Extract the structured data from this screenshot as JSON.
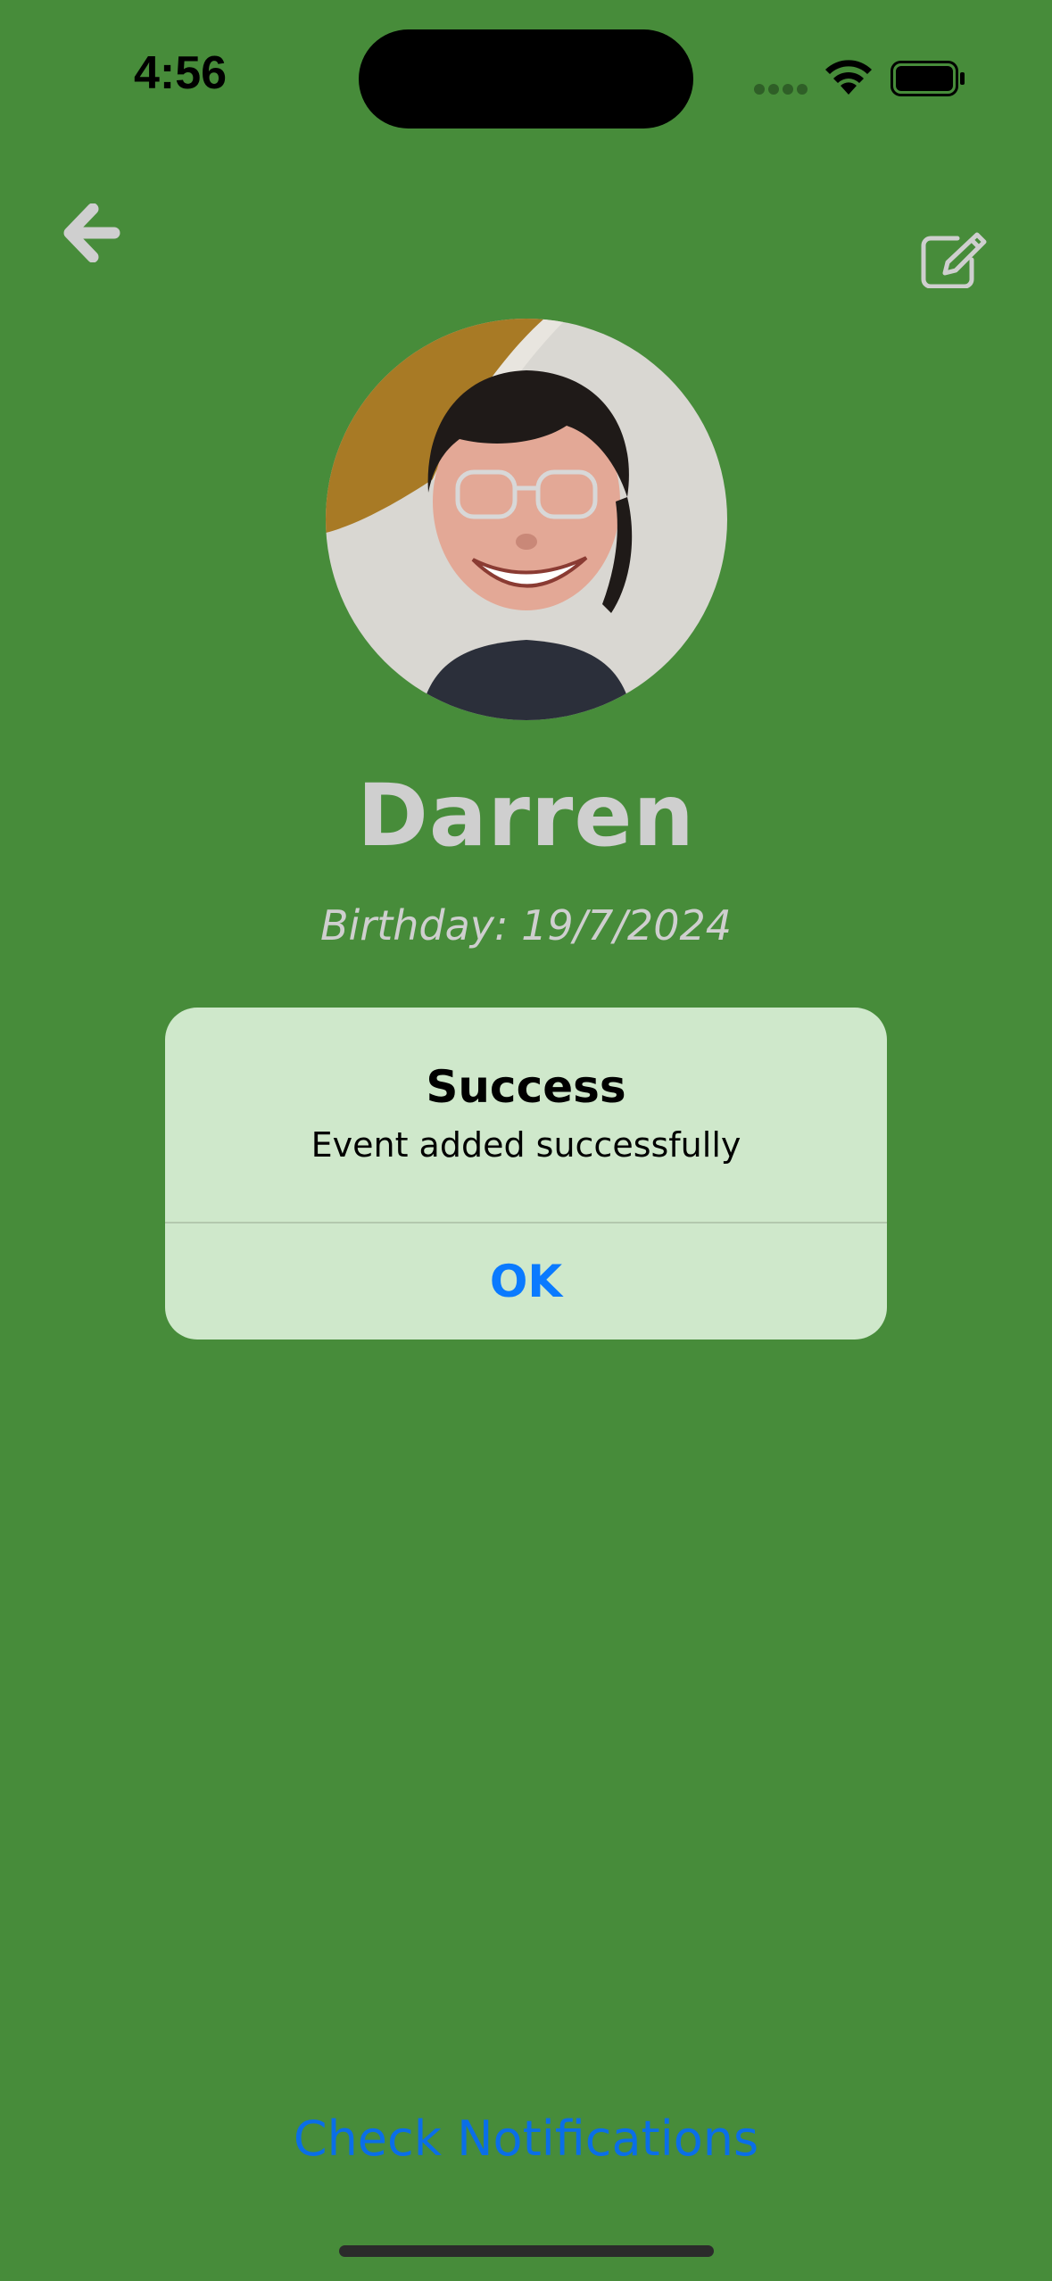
{
  "status_bar": {
    "time": "4:56"
  },
  "icons": {
    "back": "arrow-left-icon",
    "edit": "edit-square-pencil-icon",
    "wifi": "wifi-icon",
    "battery": "battery-full-icon",
    "signal": "cellular-signal-icon"
  },
  "profile": {
    "name": "Darren",
    "birthday": "Birthday: 19/7/2024"
  },
  "alert": {
    "title": "Success",
    "message": "Event added successfully",
    "ok_label": "OK"
  },
  "footer": {
    "check_notifications_label": "Check Notifications"
  },
  "colors": {
    "background": "#478c3a",
    "alert_background": "#cfe8cb",
    "link_blue": "#0a7aff",
    "muted_text": "#cfcfcf"
  }
}
